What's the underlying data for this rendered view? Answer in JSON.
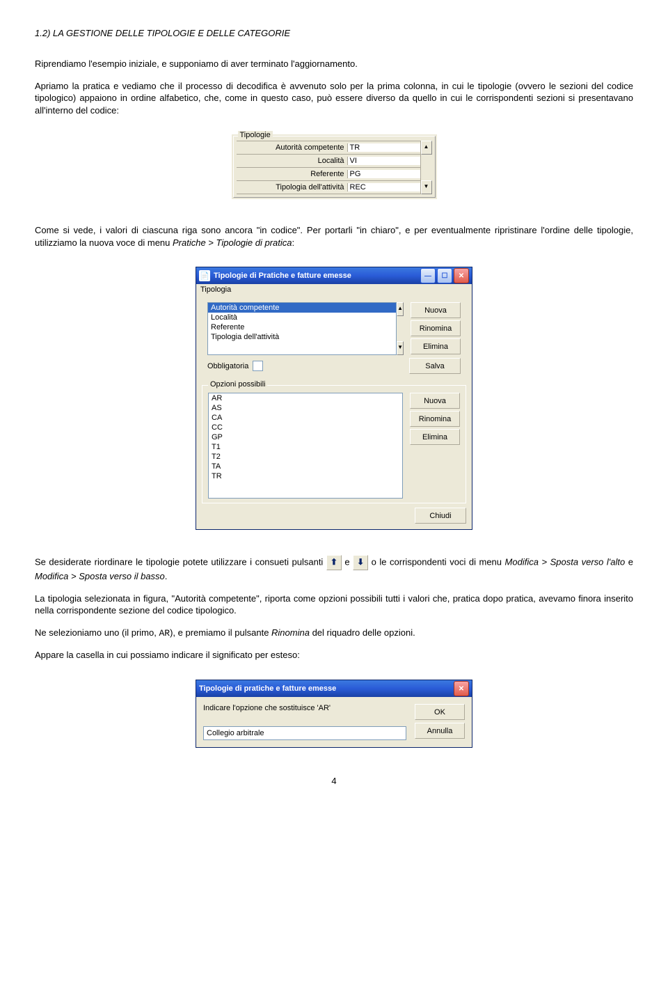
{
  "section_title": "1.2) LA GESTIONE DELLE TIPOLOGIE E DELLE CATEGORIE",
  "para1": "Riprendiamo l'esempio iniziale, e supponiamo di aver terminato l'aggiornamento.",
  "para2": "Apriamo la pratica e vediamo che il processo di decodifica è avvenuto solo per la prima colonna, in cui le tipologie (ovvero le sezioni del codice tipologico) appaiono in ordine alfabetico, che, come in questo caso, può essere diverso da quello in cui le corrispondenti sezioni si presentavano all'interno del codice:",
  "fig1": {
    "legend": "Tipologie",
    "rows": [
      {
        "label": "Autorità competente",
        "value": "TR"
      },
      {
        "label": "Località",
        "value": "VI"
      },
      {
        "label": "Referente",
        "value": "PG"
      },
      {
        "label": "Tipologia dell'attività",
        "value": "REC"
      }
    ]
  },
  "para3_a": "Come si vede, i valori di ciascuna riga sono ancora \"in codice\". Per portarli \"in chiaro\", e per eventualmente ripristinare l'ordine delle tipologie, utilizziamo la nuova voce di menu ",
  "para3_b": "Pratiche > Tipologie di pratica",
  "para3_c": ":",
  "fig2": {
    "title": "Tipologie di Pratiche e fatture emesse",
    "menu": "Tipologia",
    "list1": [
      "Autorità competente",
      "Località",
      "Referente",
      "Tipologia dell'attività"
    ],
    "btns1": [
      "Nuova",
      "Rinomina",
      "Elimina"
    ],
    "check_label": "Obbligatoria",
    "save": "Salva",
    "opzioni_label": "Opzioni possibili",
    "list2": [
      "AR",
      "AS",
      "CA",
      "CC",
      "GP",
      "T1",
      "T2",
      "TA",
      "TR"
    ],
    "btns2": [
      "Nuova",
      "Rinomina",
      "Elimina"
    ],
    "close": "Chiudi"
  },
  "para4_a": "Se desiderate riordinare le tipologie potete utilizzare i consueti pulsanti ",
  "para4_b": " e ",
  "para4_c": " o le corrispondenti voci di menu ",
  "para4_d": "Modifica > Sposta verso l'alto",
  "para4_e": " e ",
  "para4_f": "Modifica > Sposta verso il basso",
  "para4_g": ".",
  "para5": "La tipologia selezionata in figura, \"Autorità competente\", riporta come opzioni possibili tutti i valori che, pratica dopo pratica, avevamo finora inserito nella corrispondente sezione del codice tipologico.",
  "para6_a": "Ne selezioniamo uno (il primo, ",
  "para6_b": "AR",
  "para6_c": "), e premiamo il pulsante ",
  "para6_d": "Rinomina",
  "para6_e": " del riquadro delle opzioni.",
  "para7": "Appare la casella in cui possiamo indicare il significato per esteso:",
  "fig3": {
    "title": "Tipologie di pratiche e fatture emesse",
    "prompt": "Indicare l'opzione che sostituisce 'AR'",
    "value": "Collegio arbitrale",
    "ok": "OK",
    "cancel": "Annulla"
  },
  "page": "4"
}
